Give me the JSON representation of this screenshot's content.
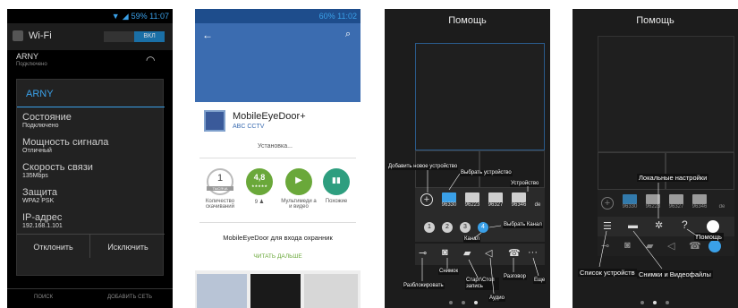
{
  "screen1": {
    "status": "59% 11:07",
    "title": "Wi-Fi",
    "toggle": "ВКЛ",
    "network_name": "ARNY",
    "network_status": "Подключено",
    "dialog_title": "ARNY",
    "rows": [
      {
        "label": "Состояние",
        "value": "Подключено"
      },
      {
        "label": "Мощность сигнала",
        "value": "Отличный"
      },
      {
        "label": "Скорость связи",
        "value": "135Mbps"
      },
      {
        "label": "Защита",
        "value": "WPA2 PSK"
      },
      {
        "label": "IP-адрес",
        "value": "192.168.1.101"
      }
    ],
    "reject": "Отклонить",
    "exclude": "Исключить",
    "bottom_search": "ПОИСК",
    "bottom_add": "ДОБАВИТЬ СЕТЬ"
  },
  "screen2": {
    "status": "60% 11:02",
    "app_name": "MobileEyeDoor+",
    "developer": "ABC CCTV",
    "install_status": "Установка...",
    "stats": [
      {
        "badge": "1",
        "sub": "ТЫСЯЧА",
        "label": "Количество скачиваний"
      },
      {
        "badge": "4,8",
        "sub": "★★★★★",
        "label": "9 ♟"
      },
      {
        "badge": "▶",
        "sub": "",
        "label": "Мультимеди а и видео"
      },
      {
        "badge": "▮▮",
        "sub": "",
        "label": "Похожие"
      }
    ],
    "description": "MobileEyeDoor для входа охранник",
    "read_more": "ЧИТАТЬ ДАЛЬШЕ"
  },
  "screen3": {
    "title": "Помощь",
    "devices": [
      "96330",
      "96223",
      "96327",
      "96346",
      "de"
    ],
    "channels": [
      "1",
      "2",
      "3",
      "4"
    ],
    "annotations": {
      "add_device": "Добавить новое устройство",
      "select_device": "Выбрать устройство",
      "device": "Устройство",
      "select_channel": "Выбрать Канал",
      "channel": "Канал",
      "snapshot": "Снимок",
      "unlock": "Разблокировать",
      "record": "Старт\\Стоп запись",
      "audio": "Аудио",
      "talk": "Разговор",
      "more": "Еще"
    }
  },
  "screen4": {
    "title": "Помощь",
    "devices": [
      "96330",
      "96223",
      "96327",
      "96346",
      "de"
    ],
    "annotations": {
      "local_settings": "Локальные настройки",
      "help": "Помощь",
      "device_list": "Список устройств",
      "media": "Снимки и Видеофайлы"
    }
  }
}
